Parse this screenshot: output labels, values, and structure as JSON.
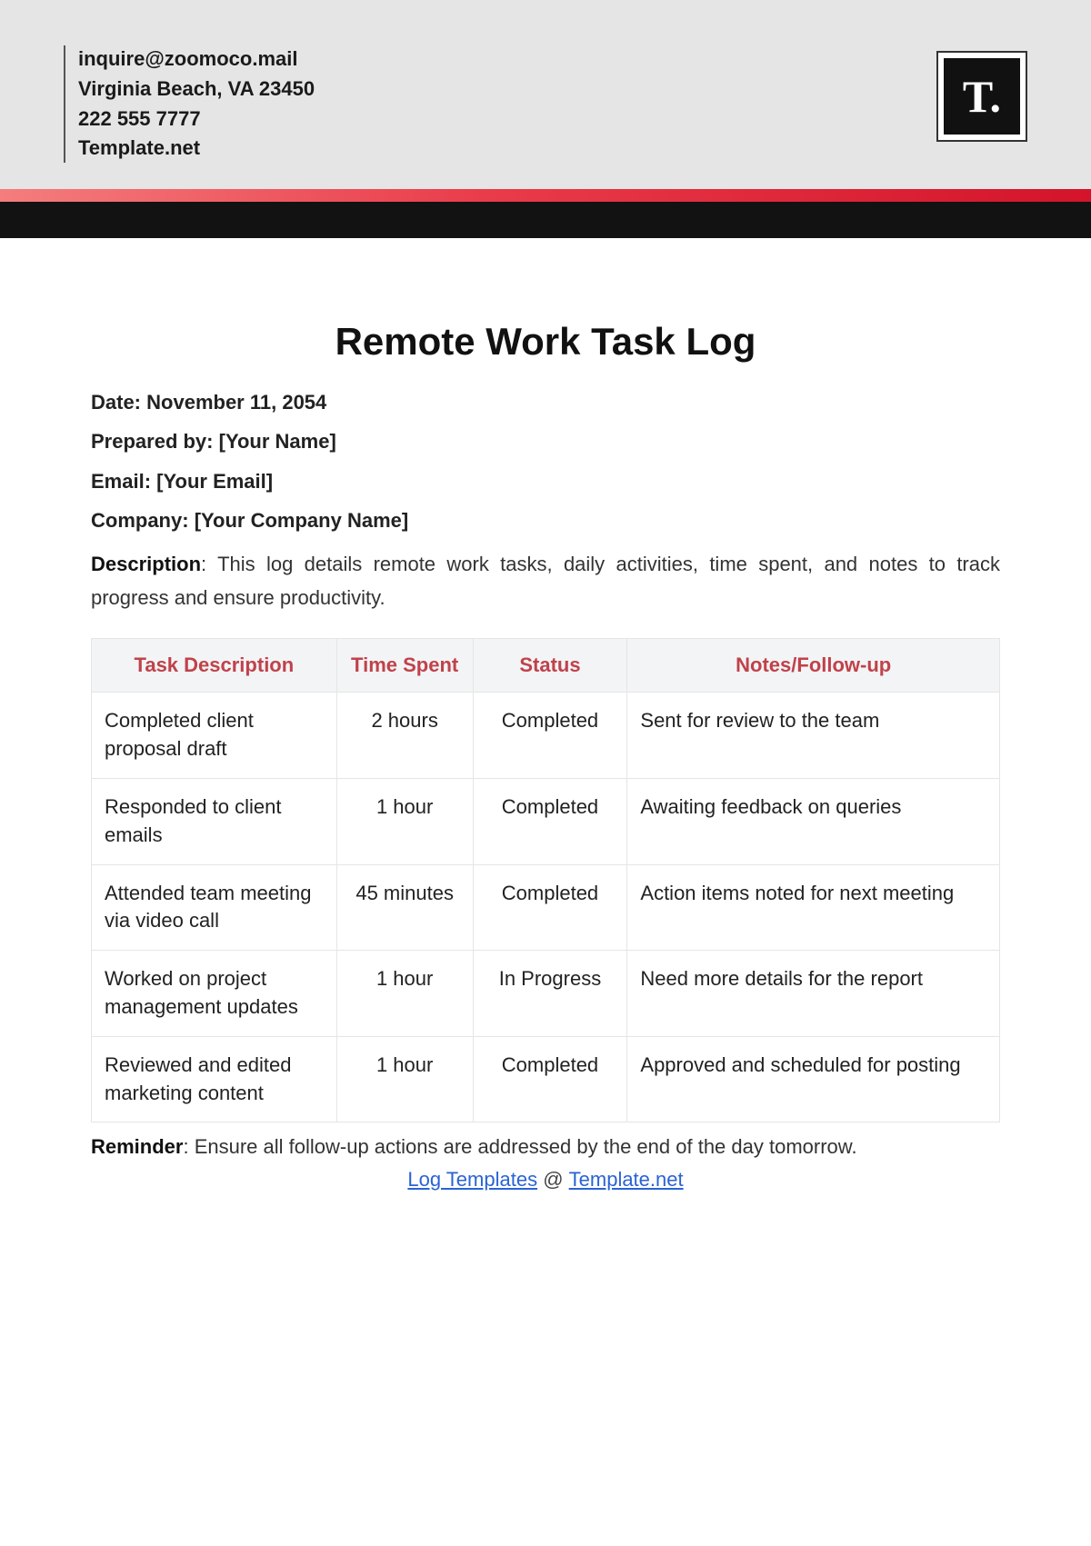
{
  "header": {
    "email": "inquire@zoomoco.mail",
    "address": "Virginia Beach, VA 23450",
    "phone": "222 555 7777",
    "site": "Template.net",
    "logo_text": "T."
  },
  "document": {
    "title": "Remote Work Task Log",
    "date_label": "Date:",
    "date_value": "November 11, 2054",
    "prepared_label": "Prepared by:",
    "prepared_value": "[Your Name]",
    "email_label": "Email:",
    "email_value": "[Your Email]",
    "company_label": "Company:",
    "company_value": "[Your Company Name]",
    "description_label": "Description",
    "description_text": ": This log details remote work tasks, daily activities, time spent, and notes to track progress and ensure productivity."
  },
  "table": {
    "headers": {
      "task": "Task Description",
      "time": "Time Spent",
      "status": "Status",
      "notes": "Notes/Follow-up"
    },
    "rows": [
      {
        "task": "Completed client proposal draft",
        "time": "2 hours",
        "status": "Completed",
        "notes": "Sent for review to the team"
      },
      {
        "task": "Responded to client emails",
        "time": "1 hour",
        "status": "Completed",
        "notes": "Awaiting feedback on queries"
      },
      {
        "task": "Attended team meeting via video call",
        "time": "45 minutes",
        "status": "Completed",
        "notes": "Action items noted for next meeting"
      },
      {
        "task": "Worked on project management updates",
        "time": "1 hour",
        "status": "In Progress",
        "notes": "Need more details for the report"
      },
      {
        "task": "Reviewed and edited marketing content",
        "time": "1 hour",
        "status": "Completed",
        "notes": "Approved and scheduled for posting"
      }
    ]
  },
  "reminder": {
    "label": "Reminder",
    "text": ": Ensure all follow-up actions are addressed by the end of the day tomorrow."
  },
  "footer": {
    "link1": "Log Templates",
    "sep": " @ ",
    "link2": "Template.net"
  }
}
